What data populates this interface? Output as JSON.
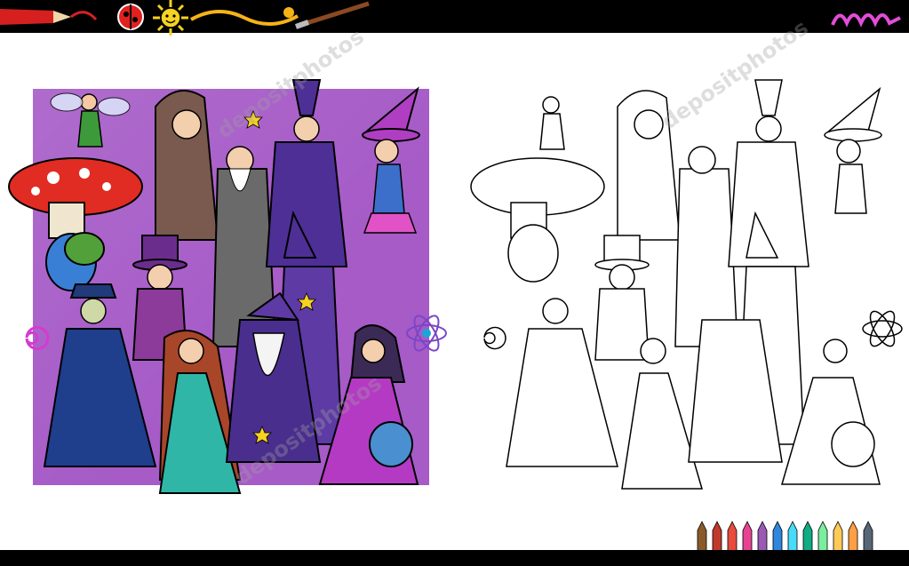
{
  "watermarks": [
    "depositphotos",
    "depositphotos",
    "depositphotos"
  ],
  "colors": {
    "panel": "#a65bc7",
    "bars": "#000000",
    "background": "#ffffff"
  },
  "icons": [
    "pencil-icon",
    "ladybug-icon",
    "sun-icon",
    "paintbrush-icon",
    "scribble-icon",
    "color-pencils-icon"
  ]
}
